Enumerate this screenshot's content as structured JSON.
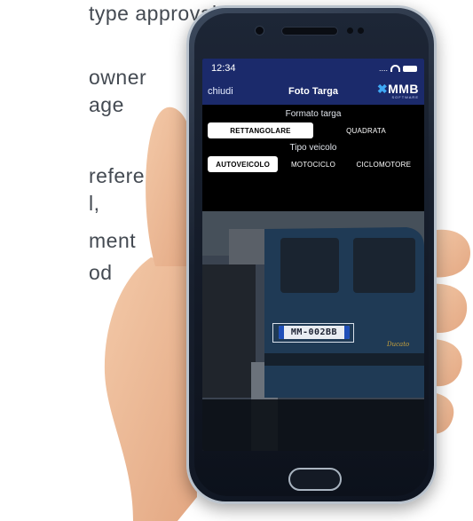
{
  "background_text": {
    "lines": [
      "type approval",
      "owner",
      "age",
      "references",
      "l,",
      "ment",
      "od"
    ]
  },
  "statusbar": {
    "time": "12:34",
    "signal": "...."
  },
  "navbar": {
    "close_label": "chiudi",
    "title": "Foto Targa",
    "logo_main": "MMB",
    "logo_sub": "SOFTWARE"
  },
  "plate_format": {
    "label": "Formato targa",
    "options": [
      "RETTANGOLARE",
      "QUADRATA"
    ],
    "selected": "RETTANGOLARE"
  },
  "vehicle_type": {
    "label": "Tipo veicolo",
    "options": [
      "AUTOVEICOLO",
      "MOTOCICLO",
      "CICLOMOTORE"
    ],
    "selected": "AUTOVEICOLO"
  },
  "camera": {
    "plate_text": "MM-002BB"
  },
  "colors": {
    "navbar": "#1b2a6b",
    "accent": "#3fa9f5",
    "phone_frame": "#18202e"
  }
}
